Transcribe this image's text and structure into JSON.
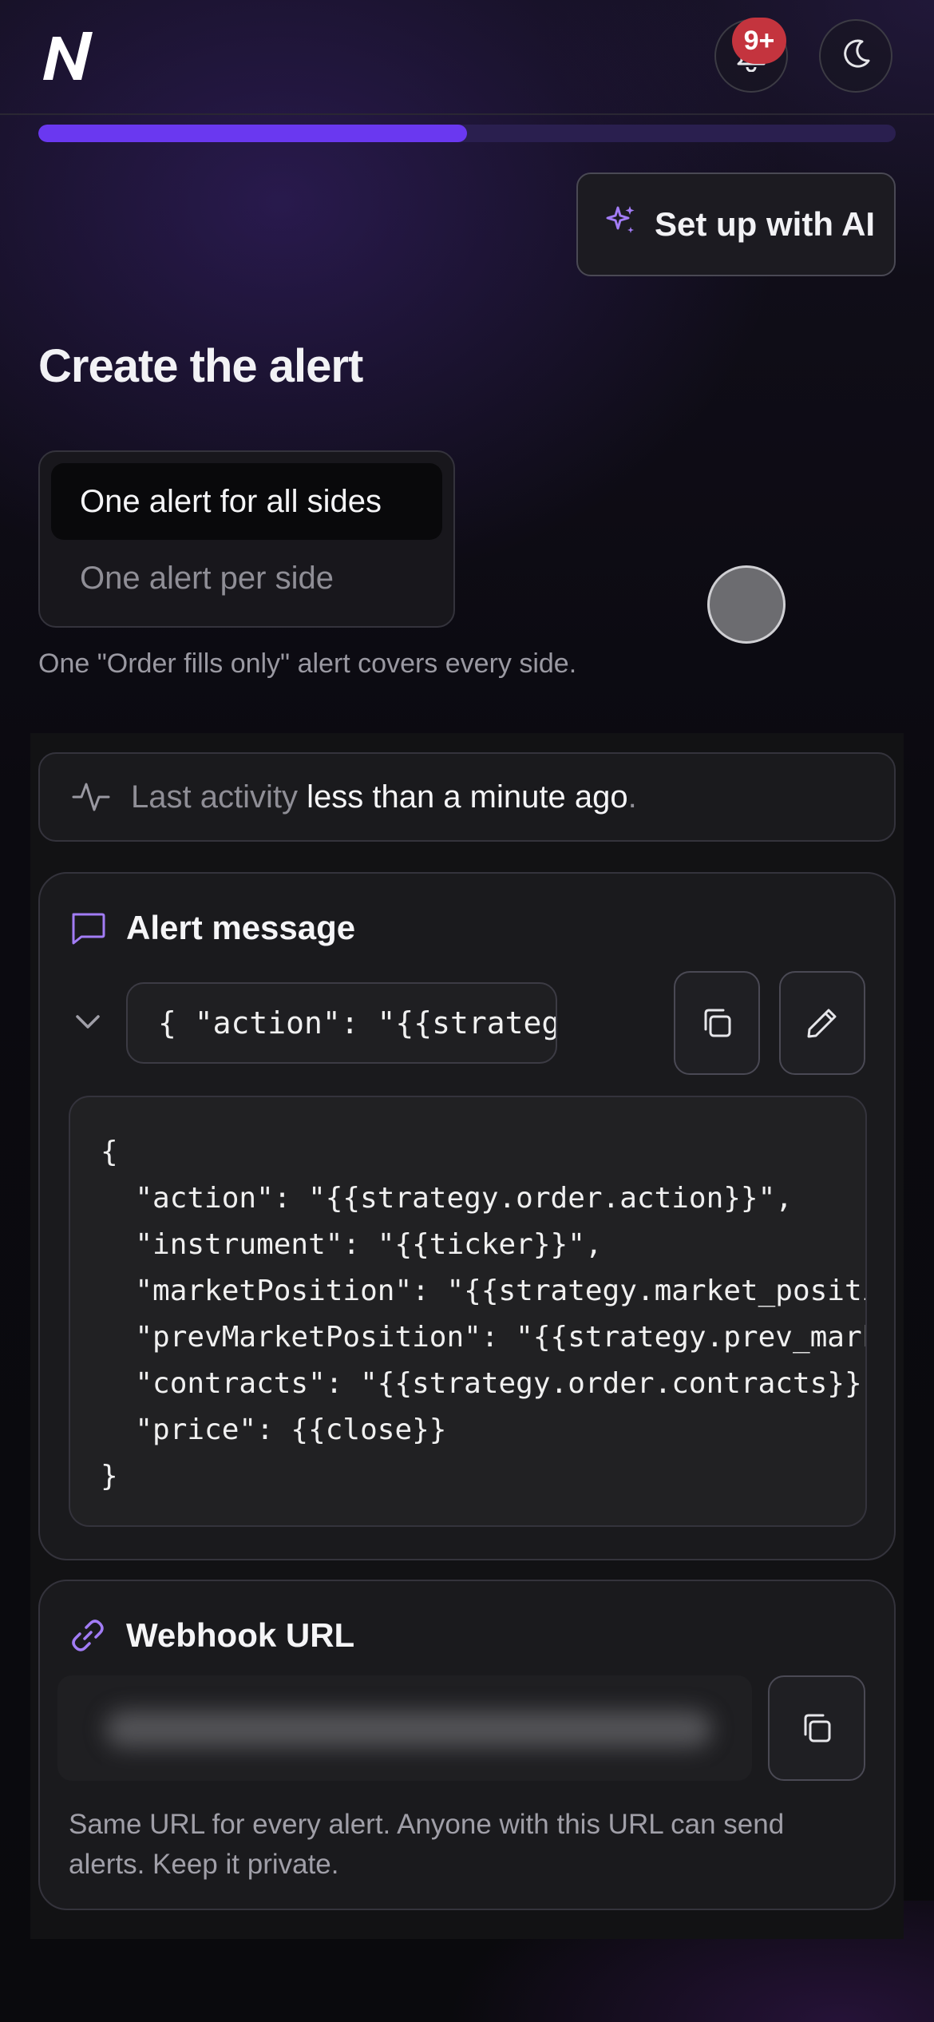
{
  "header": {
    "logo_icon": "n-brand-logo",
    "notification_badge": "9+",
    "bell_icon": "bell-icon",
    "theme_icon": "moon-icon"
  },
  "progress": {
    "fraction": 0.5
  },
  "ai_button": {
    "label": "Set up with AI",
    "icon": "sparkles-icon"
  },
  "page": {
    "title": "Create the alert",
    "mode_options": [
      {
        "label": "One alert for all sides",
        "selected": true
      },
      {
        "label": "One alert per side",
        "selected": false
      }
    ],
    "mode_hint": "One \"Order fills only\" alert covers every side."
  },
  "activity": {
    "prefix": "Last activity",
    "value": "less than a minute ago",
    "suffix": "."
  },
  "alert_message": {
    "title": "Alert message",
    "collapsed_preview": "{ \"action\": \"{{strategy.o…",
    "code_lines": [
      "{",
      "  \"action\": \"{{strategy.order.action}}\",",
      "  \"instrument\": \"{{ticker}}\",",
      "  \"marketPosition\": \"{{strategy.market_position}}\",",
      "  \"prevMarketPosition\": \"{{strategy.prev_market_position}}\",",
      "  \"contracts\": \"{{strategy.order.contracts}}\",",
      "  \"price\": {{close}}",
      "}"
    ]
  },
  "webhook": {
    "title": "Webhook URL",
    "hint": "Same URL for every alert. Anyone with this URL can send alerts. Keep it private."
  },
  "colors": {
    "accent": "#6a38f0",
    "icon_accent": "#a27cf5",
    "badge": "#c4343e",
    "card_bg": "#1a1a1d"
  }
}
